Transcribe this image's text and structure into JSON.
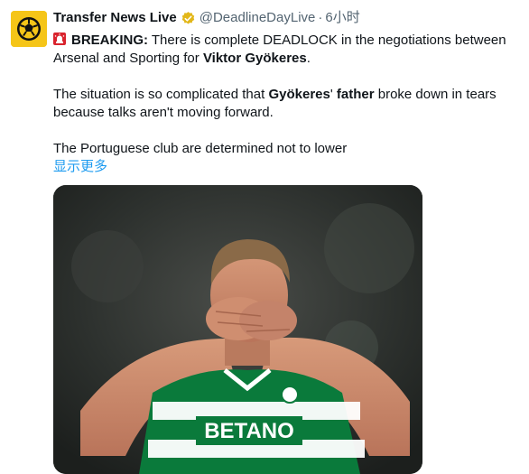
{
  "author": {
    "name": "Transfer News Live",
    "handle": "@DeadlineDayLive",
    "separator": "·",
    "time": "6小时",
    "verified": true,
    "badge_color": "#e2b719"
  },
  "tweet": {
    "line1_label": "BREAKING:",
    "line1_text": " There is complete DEADLOCK in the negotiations between Arsenal and Sporting for ",
    "line1_name": "Viktor Gyökeres",
    "line1_end": ".",
    "para2_start": "The situation is so complicated that ",
    "para2_bold1": "Gyökeres",
    "para2_mid": "' ",
    "para2_bold2": "father",
    "para2_end": " broke down in tears because talks aren't moving forward.",
    "para3": "The Portuguese club are determined not to lower",
    "show_more": "显示更多"
  },
  "media": {
    "jersey_sponsor": "BETANO",
    "jersey_colors": [
      "#0a7a3b",
      "#ffffff"
    ]
  },
  "icons": {
    "avatar": "football-logo-icon",
    "badge": "verified-badge-icon",
    "siren": "siren-emoji-icon"
  }
}
